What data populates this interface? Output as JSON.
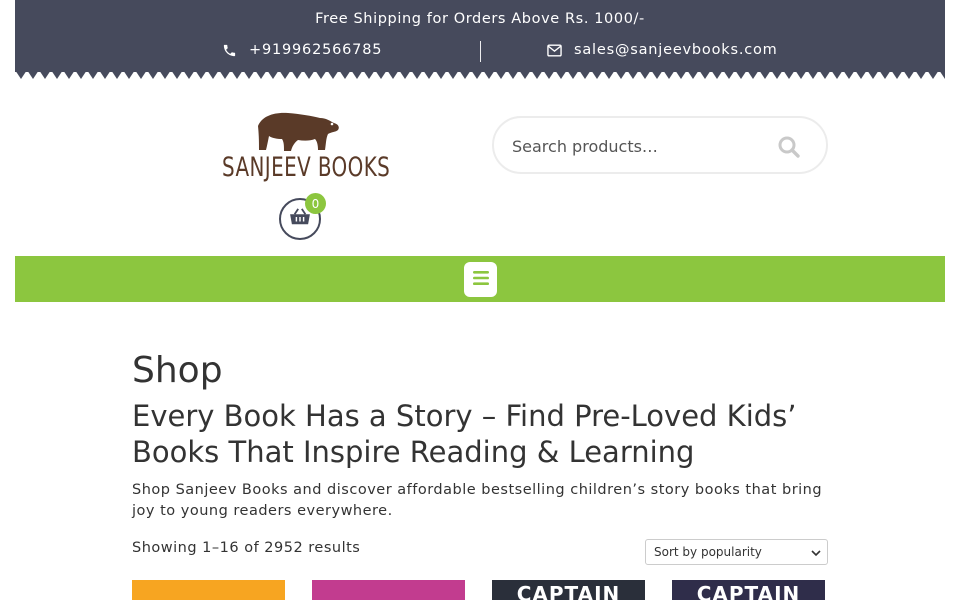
{
  "topbar": {
    "shipping_text": "Free Shipping for Orders Above Rs. 1000/-",
    "phone": "+919962566785",
    "email": "sales@sanjeevbooks.com",
    "icons": [
      "phone-icon",
      "envelope-icon"
    ],
    "background": "#464a5c"
  },
  "header": {
    "logo_text": "SANJEEV BOOKS",
    "cart_count": "0",
    "search_placeholder": "Search products…"
  },
  "nav": {
    "background": "#8cc63f",
    "menu_icon": "hamburger-icon"
  },
  "main": {
    "page_title": "Shop",
    "heading": "Every Book Has a Story – Find Pre-Loved Kids’ Books That Inspire Reading & Learning",
    "intro": "Shop Sanjeev Books and discover affordable bestselling children’s story books that bring joy to young readers everywhere.",
    "result_count": "Showing 1–16 of 2952 results",
    "sort_options": [
      "Sort by popularity"
    ],
    "sort_selected": "Sort by popularity",
    "products": [
      {
        "title": ""
      },
      {
        "title": ""
      },
      {
        "title": "CAPTAIN"
      },
      {
        "title": "CAPTAIN"
      }
    ]
  },
  "colors": {
    "accent": "#8cc63f",
    "dark": "#464a5c",
    "logo_brown": "#5a3a28"
  }
}
